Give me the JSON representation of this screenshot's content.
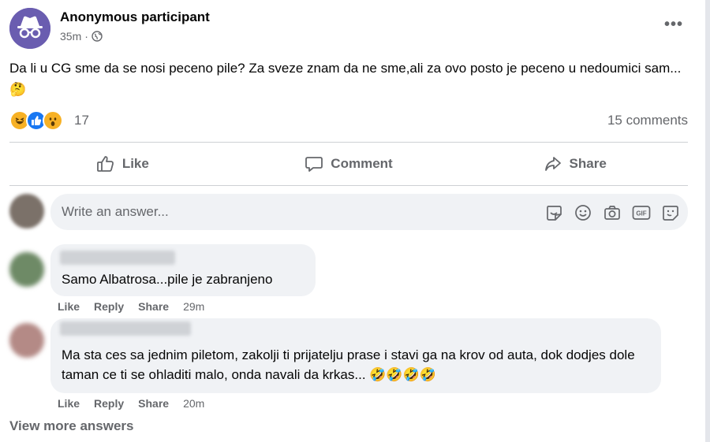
{
  "post": {
    "author": "Anonymous participant",
    "time": "35m",
    "separator": "·",
    "text": "Da li u CG sme da se nosi peceno pile? Za sveze znam da ne sme,ali za ovo posto je peceno u nedoumici sam...🤔",
    "more_label": "•••"
  },
  "reactions": {
    "icons": [
      "haha-icon",
      "like-icon",
      "wow-icon"
    ],
    "count": "17",
    "comments_count": "15 comments"
  },
  "actions": {
    "like": "Like",
    "comment": "Comment",
    "share": "Share"
  },
  "composer": {
    "placeholder": "Write an answer...",
    "tools": [
      "sticker-icon",
      "emoji-icon",
      "camera-icon",
      "gif-icon",
      "avatar-sticker-icon"
    ],
    "gif_label": "GIF"
  },
  "comments": [
    {
      "text": "Samo Albatrosa...pile je zabranjeno",
      "like": "Like",
      "reply": "Reply",
      "share": "Share",
      "time": "29m"
    },
    {
      "text": "Ma sta ces sa jednim piletom, zakolji ti prijatelju prase i stavi ga na krov od auta, dok dodjes dole taman ce ti se ohladiti malo, onda navali da krkas... 🤣🤣🤣🤣",
      "like": "Like",
      "reply": "Reply",
      "share": "Share",
      "time": "20m"
    }
  ],
  "view_more": "View more answers"
}
